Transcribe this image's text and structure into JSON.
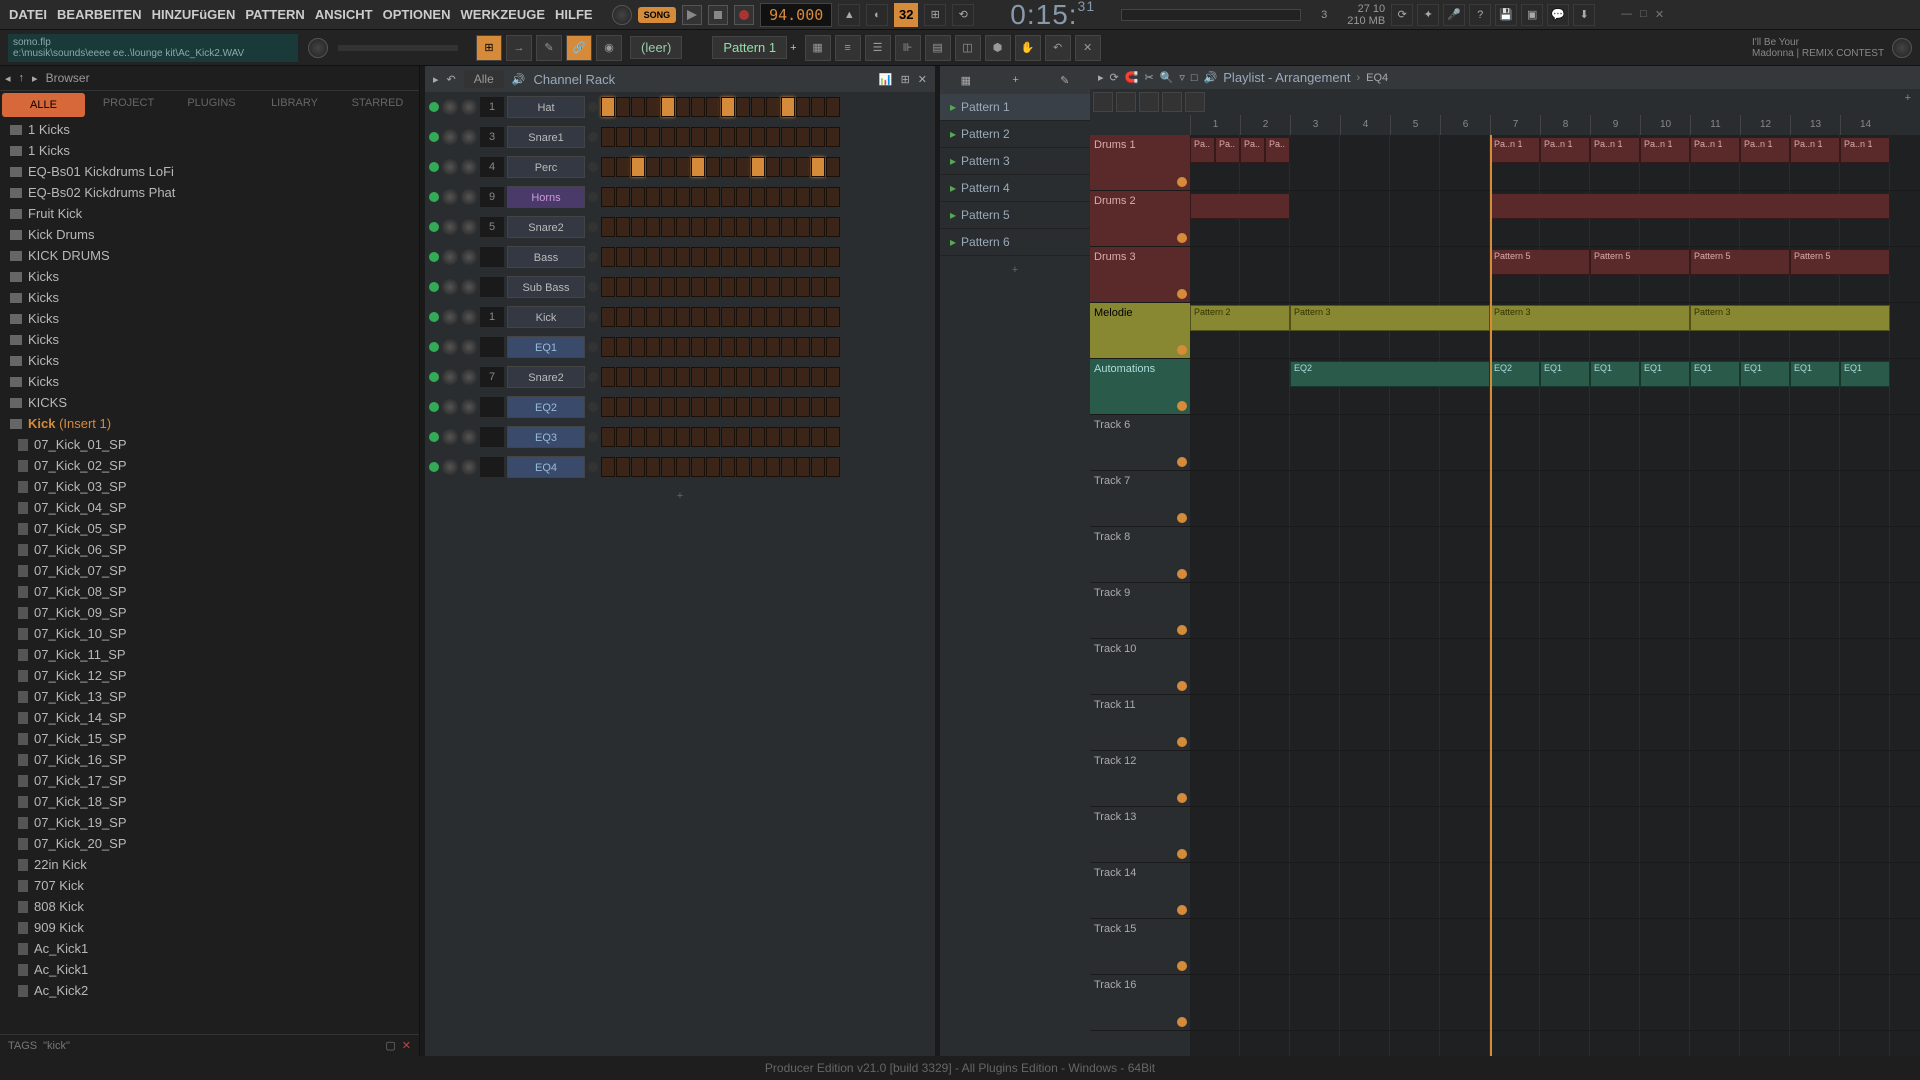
{
  "menubar": [
    "DATEI",
    "BEARBEITEN",
    "HINZUFüGEN",
    "PATTERN",
    "ANSICHT",
    "OPTIONEN",
    "WERKZEUGE",
    "HILFE"
  ],
  "toolbar": {
    "song_label": "SONG",
    "tempo": "94.000",
    "snap_label": "32",
    "time_main": "0:15:",
    "time_sub": "31",
    "voices": "3",
    "cpu_label": "27 10",
    "mem_label": "210 MB"
  },
  "hint": {
    "title": "somo.flp",
    "path": "e:\\musik\\sounds\\eeee ee..\\lounge kit\\Ac_Kick2.WAV"
  },
  "pattern_selector": "Pattern 1",
  "pattern_selector_prefix": "(leer)",
  "credits": {
    "line1": "I'll Be Your",
    "line2": "Madonna | REMIX CONTEST"
  },
  "browser": {
    "title": "Browser",
    "tabs": [
      "ALLE",
      "PROJECT",
      "PLUGINS",
      "LIBRARY",
      "STARRED"
    ],
    "folders": [
      "1 Kicks",
      "1 Kicks",
      "EQ-Bs01 Kickdrums LoFi",
      "EQ-Bs02 Kickdrums Phat",
      "Fruit Kick",
      "Kick Drums",
      "KICK DRUMS",
      "Kicks",
      "Kicks",
      "Kicks",
      "Kicks",
      "Kicks",
      "Kicks",
      "KICKS"
    ],
    "selected_folder": "Kick",
    "selected_suffix": "(Insert 1)",
    "files": [
      "07_Kick_01_SP",
      "07_Kick_02_SP",
      "07_Kick_03_SP",
      "07_Kick_04_SP",
      "07_Kick_05_SP",
      "07_Kick_06_SP",
      "07_Kick_07_SP",
      "07_Kick_08_SP",
      "07_Kick_09_SP",
      "07_Kick_10_SP",
      "07_Kick_11_SP",
      "07_Kick_12_SP",
      "07_Kick_13_SP",
      "07_Kick_14_SP",
      "07_Kick_15_SP",
      "07_Kick_16_SP",
      "07_Kick_17_SP",
      "07_Kick_18_SP",
      "07_Kick_19_SP",
      "07_Kick_20_SP",
      "22in Kick",
      "707 Kick",
      "808 Kick",
      "909 Kick",
      "Ac_Kick1",
      "Ac_Kick1",
      "Ac_Kick2"
    ],
    "tags_label": "TAGS",
    "tags_value": "\"kick\""
  },
  "channel_rack": {
    "title": "Channel Rack",
    "filter": "Alle",
    "channels": [
      {
        "num": "1",
        "name": "Hat",
        "steps": [
          1,
          0,
          0,
          0,
          1,
          0,
          0,
          0,
          1,
          0,
          0,
          0,
          1,
          0,
          0,
          0
        ]
      },
      {
        "num": "3",
        "name": "Snare1",
        "steps": [
          0,
          0,
          0,
          0,
          0,
          0,
          0,
          0,
          0,
          0,
          0,
          0,
          0,
          0,
          0,
          0
        ]
      },
      {
        "num": "4",
        "name": "Perc",
        "steps": [
          0,
          0,
          1,
          0,
          0,
          0,
          1,
          0,
          0,
          0,
          1,
          0,
          0,
          0,
          1,
          0
        ]
      },
      {
        "num": "9",
        "name": "Horns",
        "cls": "horns",
        "steps": [
          0,
          0,
          0,
          0,
          0,
          0,
          0,
          0,
          0,
          0,
          0,
          0,
          0,
          0,
          0,
          0
        ]
      },
      {
        "num": "5",
        "name": "Snare2",
        "steps": [
          0,
          0,
          0,
          0,
          0,
          0,
          0,
          0,
          0,
          0,
          0,
          0,
          0,
          0,
          0,
          0
        ]
      },
      {
        "num": "",
        "name": "Bass",
        "steps": [
          0,
          0,
          0,
          0,
          0,
          0,
          0,
          0,
          0,
          0,
          0,
          0,
          0,
          0,
          0,
          0
        ]
      },
      {
        "num": "",
        "name": "Sub Bass",
        "steps": [
          0,
          0,
          0,
          0,
          0,
          0,
          0,
          0,
          0,
          0,
          0,
          0,
          0,
          0,
          0,
          0
        ]
      },
      {
        "num": "1",
        "name": "Kick",
        "steps": [
          0,
          0,
          0,
          0,
          0,
          0,
          0,
          0,
          0,
          0,
          0,
          0,
          0,
          0,
          0,
          0
        ]
      },
      {
        "num": "",
        "name": "EQ1",
        "cls": "eq",
        "steps": [
          0,
          0,
          0,
          0,
          0,
          0,
          0,
          0,
          0,
          0,
          0,
          0,
          0,
          0,
          0,
          0
        ]
      },
      {
        "num": "7",
        "name": "Snare2",
        "steps": [
          0,
          0,
          0,
          0,
          0,
          0,
          0,
          0,
          0,
          0,
          0,
          0,
          0,
          0,
          0,
          0
        ]
      },
      {
        "num": "",
        "name": "EQ2",
        "cls": "eq",
        "steps": [
          0,
          0,
          0,
          0,
          0,
          0,
          0,
          0,
          0,
          0,
          0,
          0,
          0,
          0,
          0,
          0
        ]
      },
      {
        "num": "",
        "name": "EQ3",
        "cls": "eq",
        "steps": [
          0,
          0,
          0,
          0,
          0,
          0,
          0,
          0,
          0,
          0,
          0,
          0,
          0,
          0,
          0,
          0
        ]
      },
      {
        "num": "",
        "name": "EQ4",
        "cls": "eq",
        "steps": [
          0,
          0,
          0,
          0,
          0,
          0,
          0,
          0,
          0,
          0,
          0,
          0,
          0,
          0,
          0,
          0
        ]
      }
    ],
    "add_label": "+"
  },
  "patterns": [
    "Pattern 1",
    "Pattern 2",
    "Pattern 3",
    "Pattern 4",
    "Pattern 5",
    "Pattern 6"
  ],
  "playlist": {
    "title": "Playlist - Arrangement",
    "breadcrumb": "EQ4",
    "ruler": [
      "1",
      "2",
      "3",
      "4",
      "5",
      "6",
      "7",
      "8",
      "9",
      "10",
      "11",
      "12",
      "13",
      "14"
    ],
    "tracks": [
      {
        "name": "Drums 1",
        "cls": "drums"
      },
      {
        "name": "Drums 2",
        "cls": "drums"
      },
      {
        "name": "Drums 3",
        "cls": "drums"
      },
      {
        "name": "Melodie",
        "cls": "melodie"
      },
      {
        "name": "Automations",
        "cls": "auto"
      },
      {
        "name": "Track 6",
        "cls": ""
      },
      {
        "name": "Track 7",
        "cls": ""
      },
      {
        "name": "Track 8",
        "cls": ""
      },
      {
        "name": "Track 9",
        "cls": ""
      },
      {
        "name": "Track 10",
        "cls": ""
      },
      {
        "name": "Track 11",
        "cls": ""
      },
      {
        "name": "Track 12",
        "cls": ""
      },
      {
        "name": "Track 13",
        "cls": ""
      },
      {
        "name": "Track 14",
        "cls": ""
      },
      {
        "name": "Track 15",
        "cls": ""
      },
      {
        "name": "Track 16",
        "cls": ""
      }
    ],
    "clips": [
      {
        "track": 0,
        "start": 0,
        "len": 25,
        "label": "Pa..",
        "cls": "clip-drums"
      },
      {
        "track": 0,
        "start": 25,
        "len": 25,
        "label": "Pa..",
        "cls": "clip-drums"
      },
      {
        "track": 0,
        "start": 50,
        "len": 25,
        "label": "Pa..",
        "cls": "clip-drums"
      },
      {
        "track": 0,
        "start": 75,
        "len": 25,
        "label": "Pa..",
        "cls": "clip-drums"
      },
      {
        "track": 0,
        "start": 300,
        "len": 50,
        "label": "Pa..n 1",
        "cls": "clip-drums"
      },
      {
        "track": 0,
        "start": 350,
        "len": 50,
        "label": "Pa..n 1",
        "cls": "clip-drums"
      },
      {
        "track": 0,
        "start": 400,
        "len": 50,
        "label": "Pa..n 1",
        "cls": "clip-drums"
      },
      {
        "track": 0,
        "start": 450,
        "len": 50,
        "label": "Pa..n 1",
        "cls": "clip-drums"
      },
      {
        "track": 0,
        "start": 500,
        "len": 50,
        "label": "Pa..n 1",
        "cls": "clip-drums"
      },
      {
        "track": 0,
        "start": 550,
        "len": 50,
        "label": "Pa..n 1",
        "cls": "clip-drums"
      },
      {
        "track": 0,
        "start": 600,
        "len": 50,
        "label": "Pa..n 1",
        "cls": "clip-drums"
      },
      {
        "track": 0,
        "start": 650,
        "len": 50,
        "label": "Pa..n 1",
        "cls": "clip-drums"
      },
      {
        "track": 1,
        "start": 0,
        "len": 100,
        "label": "",
        "cls": "clip-drums"
      },
      {
        "track": 1,
        "start": 300,
        "len": 400,
        "label": "",
        "cls": "clip-drums"
      },
      {
        "track": 2,
        "start": 300,
        "len": 100,
        "label": "Pattern 5",
        "cls": "clip-drums"
      },
      {
        "track": 2,
        "start": 400,
        "len": 100,
        "label": "Pattern 5",
        "cls": "clip-drums"
      },
      {
        "track": 2,
        "start": 500,
        "len": 100,
        "label": "Pattern 5",
        "cls": "clip-drums"
      },
      {
        "track": 2,
        "start": 600,
        "len": 100,
        "label": "Pattern 5",
        "cls": "clip-drums"
      },
      {
        "track": 3,
        "start": 0,
        "len": 100,
        "label": "Pattern 2",
        "cls": "clip-mel"
      },
      {
        "track": 3,
        "start": 100,
        "len": 200,
        "label": "Pattern 3",
        "cls": "clip-mel"
      },
      {
        "track": 3,
        "start": 300,
        "len": 200,
        "label": "Pattern 3",
        "cls": "clip-mel"
      },
      {
        "track": 3,
        "start": 500,
        "len": 200,
        "label": "Pattern 3",
        "cls": "clip-mel"
      },
      {
        "track": 4,
        "start": 100,
        "len": 200,
        "label": "EQ2",
        "cls": "clip-auto"
      },
      {
        "track": 4,
        "start": 300,
        "len": 50,
        "label": "EQ2",
        "cls": "clip-auto"
      },
      {
        "track": 4,
        "start": 350,
        "len": 50,
        "label": "EQ1",
        "cls": "clip-auto"
      },
      {
        "track": 4,
        "start": 400,
        "len": 50,
        "label": "EQ1",
        "cls": "clip-auto"
      },
      {
        "track": 4,
        "start": 450,
        "len": 50,
        "label": "EQ1",
        "cls": "clip-auto"
      },
      {
        "track": 4,
        "start": 500,
        "len": 50,
        "label": "EQ1",
        "cls": "clip-auto"
      },
      {
        "track": 4,
        "start": 550,
        "len": 50,
        "label": "EQ1",
        "cls": "clip-auto"
      },
      {
        "track": 4,
        "start": 600,
        "len": 50,
        "label": "EQ1",
        "cls": "clip-auto"
      },
      {
        "track": 4,
        "start": 650,
        "len": 50,
        "label": "EQ1",
        "cls": "clip-auto"
      }
    ]
  },
  "footer": "Producer Edition v21.0 [build 3329] - All Plugins Edition - Windows - 64Bit"
}
